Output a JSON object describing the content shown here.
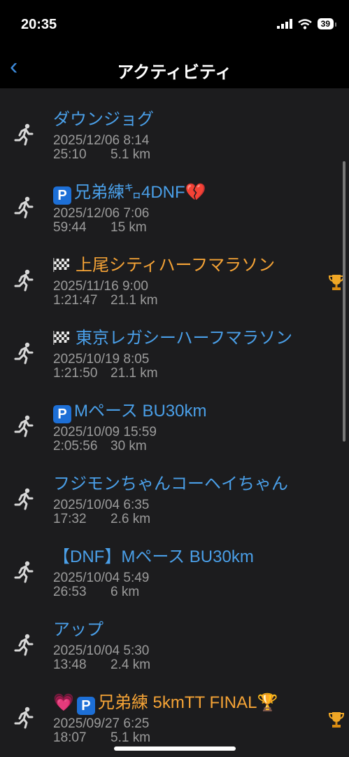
{
  "status": {
    "time": "20:35",
    "battery": "39"
  },
  "nav": {
    "back_glyph": "‹",
    "title": "アクティビティ"
  },
  "activities": [
    {
      "title": "ダウンジョグ",
      "date": "2025/12/06 8:14",
      "duration": "25:10",
      "distance": "5.1 km",
      "color": "blue"
    },
    {
      "badge": "P",
      "title": "兄弟練㌔4DNF💔",
      "date": "2025/12/06 7:06",
      "duration": "59:44",
      "distance": "15 km",
      "color": "blue"
    },
    {
      "flag": true,
      "title": "上尾シティハーフマラソン",
      "date": "2025/11/16 9:00",
      "duration": "1:21:47",
      "distance": "21.1 km",
      "color": "orange",
      "trophy": true
    },
    {
      "flag": true,
      "title": "東京レガシーハーフマラソン",
      "date": "2025/10/19 8:05",
      "duration": "1:21:50",
      "distance": "21.1 km",
      "color": "blue"
    },
    {
      "badge": "P",
      "title": "Mペース BU30km",
      "date": "2025/10/09 15:59",
      "duration": "2:05:56",
      "distance": "30 km",
      "color": "blue"
    },
    {
      "title": "フジモンちゃんコーヘイちゃん",
      "date": "2025/10/04 6:35",
      "duration": "17:32",
      "distance": "2.6 km",
      "color": "blue"
    },
    {
      "title": "【DNF】Mペース BU30km",
      "date": "2025/10/04 5:49",
      "duration": "26:53",
      "distance": "6 km",
      "color": "blue"
    },
    {
      "title": "アップ",
      "date": "2025/10/04 5:30",
      "duration": "13:48",
      "distance": "2.4 km",
      "color": "blue"
    },
    {
      "heart": "💗",
      "badge": "P",
      "title": "兄弟練 5kmTT FINAL🏆",
      "date": "2025/09/27 6:25",
      "duration": "18:07",
      "distance": "5.1 km",
      "color": "orange",
      "trophy": true
    }
  ],
  "colors": {
    "blue": "#4a9fe8",
    "orange": "#f5a336",
    "bg": "#1c1c1e"
  },
  "icons": {
    "row": "running-person-icon",
    "award": "trophy-icon",
    "back": "chevron-left-icon"
  }
}
